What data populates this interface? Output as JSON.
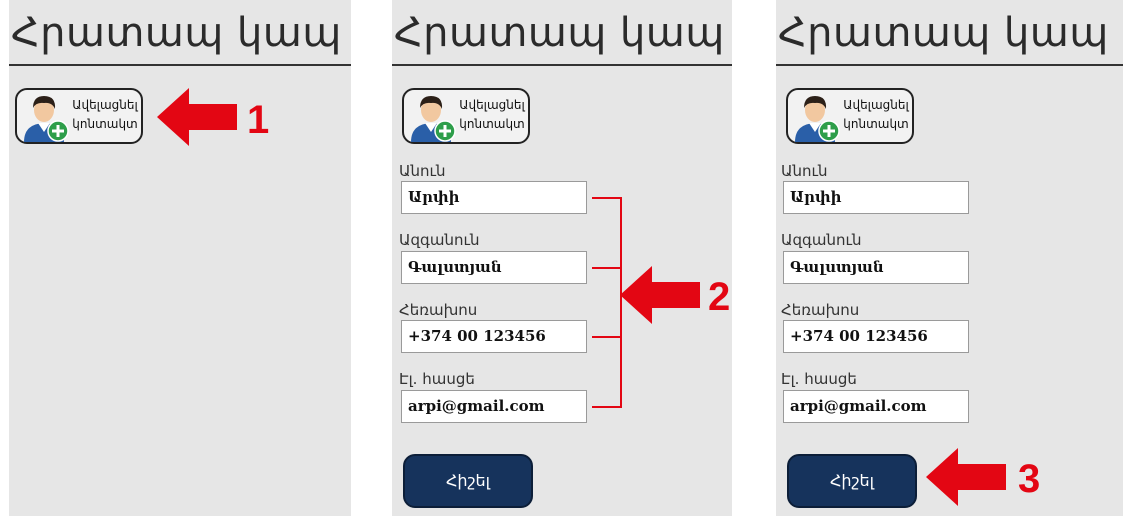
{
  "screen": {
    "title": "Հրատապ կապ",
    "add_contact": {
      "line1": "Ավելացնել",
      "line2": "կոնտակտ",
      "icon": "person-add-icon"
    },
    "fields": [
      {
        "label": "Անուն",
        "value": "Արփի"
      },
      {
        "label": "Ազգանուն",
        "value": "Գալստյան"
      },
      {
        "label": "Հեռախոս",
        "value": "+374 00 123456"
      },
      {
        "label": "Էլ. հասցե",
        "value": "arpi@gmail.com"
      }
    ],
    "save_label": "Հիշել"
  },
  "steps": [
    "1",
    "2",
    "3"
  ],
  "colors": {
    "accent_red": "#e30613",
    "button_navy": "#16335c",
    "panel_bg": "#e6e6e6"
  }
}
